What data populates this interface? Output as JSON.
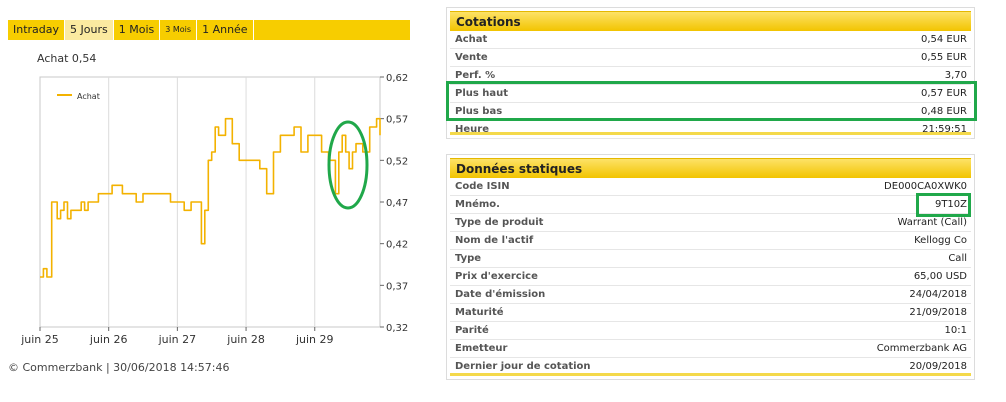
{
  "tabs": [
    {
      "label": "Intraday",
      "active": false,
      "small": false
    },
    {
      "label": "5 Jours",
      "active": true,
      "small": false
    },
    {
      "label": "1 Mois",
      "active": false,
      "small": false
    },
    {
      "label": "3 Mois",
      "active": false,
      "small": true
    },
    {
      "label": "1 Année",
      "active": false,
      "small": false
    }
  ],
  "price_label": "Achat 0,54",
  "copyright": "© Commerzbank | 30/06/2018 14:57:46",
  "chart_data": {
    "type": "line",
    "legend_placement": "top-left",
    "ylim": [
      0.32,
      0.62
    ],
    "y_ticks": [
      "0,62",
      "0,57",
      "0,52",
      "0,47",
      "0,42",
      "0,37",
      "0,32"
    ],
    "y_tick_values": [
      0.62,
      0.57,
      0.52,
      0.47,
      0.42,
      0.37,
      0.32
    ],
    "x_ticks": [
      "juin 25",
      "juin 26",
      "juin 27",
      "juin 28",
      "juin 29"
    ],
    "x_range": [
      0,
      4.95
    ],
    "grid": "vertical",
    "color": "#f3b200",
    "series": [
      {
        "name": "Achat",
        "x": [
          0.0,
          0.05,
          0.1,
          0.13,
          0.17,
          0.25,
          0.3,
          0.35,
          0.4,
          0.45,
          0.5,
          0.55,
          0.6,
          0.65,
          0.7,
          0.75,
          0.8,
          0.85,
          0.9,
          0.95,
          1.0,
          1.05,
          1.1,
          1.2,
          1.3,
          1.4,
          1.5,
          1.6,
          1.7,
          1.8,
          1.9,
          2.0,
          2.1,
          2.2,
          2.3,
          2.35,
          2.4,
          2.45,
          2.5,
          2.55,
          2.6,
          2.7,
          2.8,
          2.9,
          3.0,
          3.1,
          3.2,
          3.3,
          3.4,
          3.5,
          3.6,
          3.7,
          3.8,
          3.9,
          4.0,
          4.1,
          4.15,
          4.2,
          4.25,
          4.3,
          4.35,
          4.4,
          4.45,
          4.5,
          4.55,
          4.6,
          4.7,
          4.8,
          4.9,
          4.95
        ],
        "values": [
          0.38,
          0.39,
          0.38,
          0.38,
          0.47,
          0.45,
          0.46,
          0.47,
          0.45,
          0.46,
          0.46,
          0.46,
          0.47,
          0.46,
          0.47,
          0.47,
          0.47,
          0.48,
          0.48,
          0.48,
          0.48,
          0.49,
          0.49,
          0.48,
          0.48,
          0.47,
          0.48,
          0.48,
          0.48,
          0.48,
          0.47,
          0.47,
          0.46,
          0.47,
          0.47,
          0.42,
          0.46,
          0.52,
          0.53,
          0.56,
          0.55,
          0.57,
          0.54,
          0.52,
          0.52,
          0.52,
          0.51,
          0.48,
          0.53,
          0.55,
          0.55,
          0.56,
          0.53,
          0.55,
          0.55,
          0.53,
          0.53,
          0.52,
          0.52,
          0.48,
          0.53,
          0.55,
          0.53,
          0.51,
          0.53,
          0.54,
          0.53,
          0.56,
          0.57,
          0.55
        ]
      }
    ]
  },
  "cotations": {
    "title": "Cotations",
    "rows": [
      {
        "label": "Achat",
        "value": "0,54 EUR"
      },
      {
        "label": "Vente",
        "value": "0,55 EUR"
      },
      {
        "label": "Perf. %",
        "value": "3,70"
      },
      {
        "label": "Plus haut",
        "value": "0,57 EUR"
      },
      {
        "label": "Plus bas",
        "value": "0,48 EUR"
      },
      {
        "label": "Heure",
        "value": "21:59:51"
      }
    ]
  },
  "donnees": {
    "title": "Données statiques",
    "rows": [
      {
        "label": "Code ISIN",
        "value": "DE000CA0XWK0"
      },
      {
        "label": "Mnémo.",
        "value": "9T10Z"
      },
      {
        "label": "Type de produit",
        "value": "Warrant (Call)"
      },
      {
        "label": "Nom de l'actif",
        "value": "Kellogg Co"
      },
      {
        "label": "Type",
        "value": "Call"
      },
      {
        "label": "Prix d'exercice",
        "value": "65,00 USD"
      },
      {
        "label": "Date d'émission",
        "value": "24/04/2018"
      },
      {
        "label": "Maturité",
        "value": "21/09/2018"
      },
      {
        "label": "Parité",
        "value": "10:1"
      },
      {
        "label": "Emetteur",
        "value": "Commerzbank AG"
      },
      {
        "label": "Dernier jour de cotation",
        "value": "20/09/2018"
      }
    ]
  },
  "colors": {
    "highlight": "#20a84a",
    "accent": "#f7cd00",
    "line": "#f3b200"
  }
}
